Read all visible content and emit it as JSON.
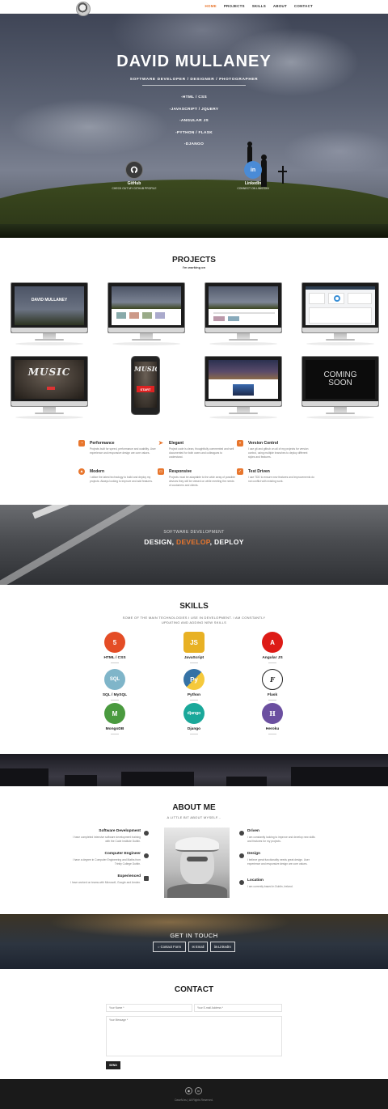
{
  "nav": {
    "items": [
      {
        "label": "HOME",
        "active": true
      },
      {
        "label": "PROJECTS",
        "active": false
      },
      {
        "label": "SKILLS",
        "active": false
      },
      {
        "label": "ABOUT",
        "active": false
      },
      {
        "label": "CONTACT",
        "active": false
      }
    ]
  },
  "hero": {
    "title": "DAVID MULLANEY",
    "subtitle": "SOFTWARE DEVELOPER / DESIGNER / PHOTOGRAPHER",
    "skills_list": [
      "-HTML / CSS",
      "-JAVASCRIPT / JQUERY",
      "-ANGULAR JS",
      "-PYTHON / FLASK",
      "-DJANGO"
    ],
    "github": {
      "label": "GitHub",
      "caption": "CHECK OUT MY GITHUB PROFILE",
      "icon": "github-icon"
    },
    "linkedin": {
      "label": "LinkedIn",
      "caption": "CONNECT ON LINKEDIN",
      "icon": "linkedin-icon"
    }
  },
  "projects": {
    "title": "PROJECTS",
    "subtitle": "I'm working on",
    "items": [
      {
        "screen_title": "DAVID MULLANEY"
      },
      {
        "screen_title": ""
      },
      {
        "screen_title": ""
      },
      {
        "screen_title": ""
      },
      {
        "screen_title": "MUSIC"
      },
      {
        "screen_title": "MUSIC",
        "button": "START"
      },
      {
        "screen_title": ""
      },
      {
        "screen_title": "COMING SOON"
      }
    ]
  },
  "features": [
    {
      "title": "Performance",
      "desc": "Projects built for speed, performance and usability. User experience and responsive design are core values.",
      "icon": "speed-icon"
    },
    {
      "title": "Elegant",
      "desc": "Project code is clean, thoughtfully commented and well documented for both users and colleagues to understand.",
      "icon": "send-icon"
    },
    {
      "title": "Version Control",
      "desc": "I use git and github on all of my projects for version control, using multiple branches to deploy different styles and features.",
      "icon": "branch-icon"
    },
    {
      "title": "Modern",
      "desc": "I utilize the latest technology to build and deploy my projects. Always looking to improve and add features.",
      "icon": "rocket-icon"
    },
    {
      "title": "Responsive",
      "desc": "Projects must be adaptable to the wide array of possible devices they will be viewed on while meeting the needs of customers and clients.",
      "icon": "devices-icon"
    },
    {
      "title": "Test Driven",
      "desc": "I use TDD to ensure new features and improvements do not conflict with existing work.",
      "icon": "check-icon"
    }
  ],
  "band": {
    "kicker": "SOFTWARE DEVELOPMENT",
    "word1": "DESIGN, ",
    "word2": "DEVELOP",
    "word3": ", DEPLOY"
  },
  "skills": {
    "title": "SKILLS",
    "subtitle_1": "SOME OF THE MAIN TECHNOLOGIES I USE IN DEVELOPMENT. I AM CONSTANTLY",
    "subtitle_2": "UPDATING AND ADDING NEW SKILLS",
    "items": [
      {
        "name": "HTML / CSS",
        "glyph": "5",
        "color": "#e44d26"
      },
      {
        "name": "JavaScript",
        "glyph": "JS",
        "color": "#e8b124"
      },
      {
        "name": "Angular JS",
        "glyph": "A",
        "color": "#dd1b16"
      },
      {
        "name": "SQL / MySQL",
        "glyph": "SQL",
        "color": "#7fb5c9"
      },
      {
        "name": "Python",
        "glyph": "Py",
        "color": "#3572a5"
      },
      {
        "name": "Flask",
        "glyph": "F",
        "color": "#222222"
      },
      {
        "name": "MongoDB",
        "glyph": "M",
        "color": "#4a9a3f"
      },
      {
        "name": "Django",
        "glyph": "django",
        "color": "#1aa89a"
      },
      {
        "name": "Heroku",
        "glyph": "H",
        "color": "#6b4fa0"
      }
    ]
  },
  "about": {
    "title": "ABOUT ME",
    "subtitle": "A LITTLE BIT ABOUT MYSELF...",
    "left": [
      {
        "title": "Software Development",
        "desc": "I have completed intensive software development training with the Code Institute Dublin.",
        "icon": "briefcase-icon"
      },
      {
        "title": "Computer Engineer",
        "desc": "I have a degree in Computer Engineering and Maths from Trinity College Dublin.",
        "icon": "cogs-icon"
      },
      {
        "title": "Experienced",
        "desc": "I have worked on teams with Microsoft, Google and Amdex.",
        "icon": "building-icon"
      }
    ],
    "right": [
      {
        "title": "Driven",
        "desc": "I am constantly looking to improve and develop new skills and features for my projects.",
        "icon": "car-icon"
      },
      {
        "title": "Design",
        "desc": "I believe great functionality needs great design. User experience and responsive design are core values.",
        "icon": "brush-icon"
      },
      {
        "title": "Location",
        "desc": "I am currently based in Dublin, Ireland.",
        "icon": "globe-icon"
      }
    ]
  },
  "touch": {
    "title": "GET IN TOUCH",
    "buttons": [
      "Contact Form",
      "Email",
      "LinkedIn"
    ]
  },
  "contact": {
    "title": "CONTACT",
    "name_placeholder": "Your Name *",
    "email_placeholder": "Your E-mail Address *",
    "message_placeholder": "Your Message *",
    "send_label": "SEND"
  },
  "footer": {
    "copyright": "DaveM.eu | All Rights Reserved."
  },
  "colors": {
    "accent": "#e8762d"
  }
}
